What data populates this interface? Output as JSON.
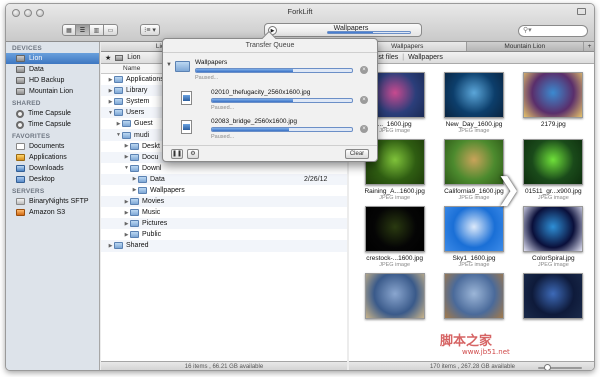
{
  "window": {
    "title": "ForkLift"
  },
  "toolbar": {
    "activity_label": "Wallpapers",
    "search_placeholder": "",
    "view_icons": [
      "icon-view-icon",
      "list-view-icon",
      "column-view-icon",
      "coverflow-view-icon"
    ],
    "action_label": "⁝≡ ▾"
  },
  "sidebar": {
    "sections": [
      {
        "title": "DEVICES",
        "items": [
          {
            "label": "Lion",
            "icon": "disk",
            "selected": true
          },
          {
            "label": "Data",
            "icon": "disk"
          },
          {
            "label": "HD Backup",
            "icon": "disk"
          },
          {
            "label": "Mountain Lion",
            "icon": "disk"
          }
        ]
      },
      {
        "title": "SHARED",
        "items": [
          {
            "label": "Time Capsule",
            "icon": "tm"
          },
          {
            "label": "Time Capsule",
            "icon": "tm"
          }
        ]
      },
      {
        "title": "FAVORITES",
        "items": [
          {
            "label": "Documents",
            "icon": "doc"
          },
          {
            "label": "Applications",
            "icon": "app"
          },
          {
            "label": "Downloads",
            "icon": "dl"
          },
          {
            "label": "Desktop",
            "icon": "desk"
          }
        ]
      },
      {
        "title": "SERVERS",
        "items": [
          {
            "label": "BinaryNights SFTP",
            "icon": "srv"
          },
          {
            "label": "Amazon S3",
            "icon": "s3"
          }
        ]
      }
    ]
  },
  "left_pane": {
    "tabs": [
      "Lion",
      ""
    ],
    "path": "Lion",
    "column_name": "Name",
    "rows": [
      {
        "label": "Applications",
        "indent": 0,
        "open": false
      },
      {
        "label": "Library",
        "indent": 0,
        "open": false
      },
      {
        "label": "System",
        "indent": 0,
        "open": false
      },
      {
        "label": "Users",
        "indent": 0,
        "open": true
      },
      {
        "label": "Guest",
        "indent": 1,
        "open": false
      },
      {
        "label": "mudi",
        "indent": 1,
        "open": true
      },
      {
        "label": "Deskt",
        "indent": 2,
        "open": false
      },
      {
        "label": "Docu",
        "indent": 2,
        "open": false
      },
      {
        "label": "Downl",
        "indent": 2,
        "open": true
      },
      {
        "label": "Data",
        "indent": 3,
        "open": false
      },
      {
        "label": "Wallpapers",
        "indent": 3,
        "open": false
      },
      {
        "label": "Movies",
        "indent": 2,
        "open": false
      },
      {
        "label": "Music",
        "indent": 2,
        "open": false
      },
      {
        "label": "Pictures",
        "indent": 2,
        "open": false
      },
      {
        "label": "Public",
        "indent": 2,
        "open": false
      },
      {
        "label": "Shared",
        "indent": 0,
        "open": false
      }
    ],
    "date_fragment": "2/26/12",
    "status": "16 items , 66.21 GB available"
  },
  "right_pane": {
    "tabs": [
      "Wallpapers",
      "Mountain Lion"
    ],
    "path_items": [
      "ata",
      "test files",
      "Wallpapers"
    ],
    "thumbnails": [
      {
        "name": "..._1600.jpg",
        "type": "JPEG image",
        "colors": [
          "#2b3e7a",
          "#c84a8f",
          "#1a2a55"
        ]
      },
      {
        "name": "New_Day_1600.jpg",
        "type": "JPEG image",
        "colors": [
          "#0c3e6b",
          "#5ba6d9",
          "#0a2440"
        ]
      },
      {
        "name": "2179.jpg",
        "type": "",
        "colors": [
          "#5a2e6b",
          "#3b8ad0",
          "#e6c36a"
        ]
      },
      {
        "name": "Raining_A...1600.jpg",
        "type": "JPEG image",
        "colors": [
          "#2f5d12",
          "#7fc23a",
          "#1f3d0a"
        ]
      },
      {
        "name": "California9_1600.jpg",
        "type": "JPEG image",
        "colors": [
          "#4c8a2e",
          "#c9a35a",
          "#2e5a18"
        ]
      },
      {
        "name": "01511_gr...x900.jpg",
        "type": "JPEG image",
        "colors": [
          "#1a4a1a",
          "#6fe03a",
          "#0e2e0e"
        ]
      },
      {
        "name": "crestock-...1600.jpg",
        "type": "JPEG image",
        "colors": [
          "#050505",
          "#2a3a10",
          "#000"
        ]
      },
      {
        "name": "Sky1_1600.jpg",
        "type": "JPEG image",
        "colors": [
          "#1a6fd6",
          "#dce9fa",
          "#3d8be8"
        ]
      },
      {
        "name": "ColorSpiral.jpg",
        "type": "JPEG image",
        "colors": [
          "#0a0f3a",
          "#2e8fd6",
          "#e3e3f5"
        ]
      },
      {
        "name": "",
        "type": "",
        "colors": [
          "#3a5a8a",
          "#8aa6cf",
          "#c9b48a"
        ]
      },
      {
        "name": "",
        "type": "",
        "colors": [
          "#4a6a9a",
          "#9cb6d8",
          "#a37a4a"
        ]
      },
      {
        "name": "",
        "type": "",
        "colors": [
          "#0e1a3a",
          "#3d6ab8",
          "#1a2a4a"
        ]
      }
    ],
    "status": "170 items , 267.28 GB available"
  },
  "transfer_queue": {
    "title": "Transfer Queue",
    "items": [
      {
        "name": "Wallpapers",
        "status": "Paused...",
        "progress": 0.62,
        "kind": "folder"
      },
      {
        "name": "02010_thefugacity_2560x1600.jpg",
        "status": "Paused...",
        "progress": 0.58,
        "kind": "file"
      },
      {
        "name": "02083_bridge_2560x1600.jpg",
        "status": "Paused...",
        "progress": 0.55,
        "kind": "file"
      }
    ],
    "clear_label": "Clear"
  },
  "watermark": {
    "text": "脚本之家",
    "url": "www.jb51.net"
  }
}
